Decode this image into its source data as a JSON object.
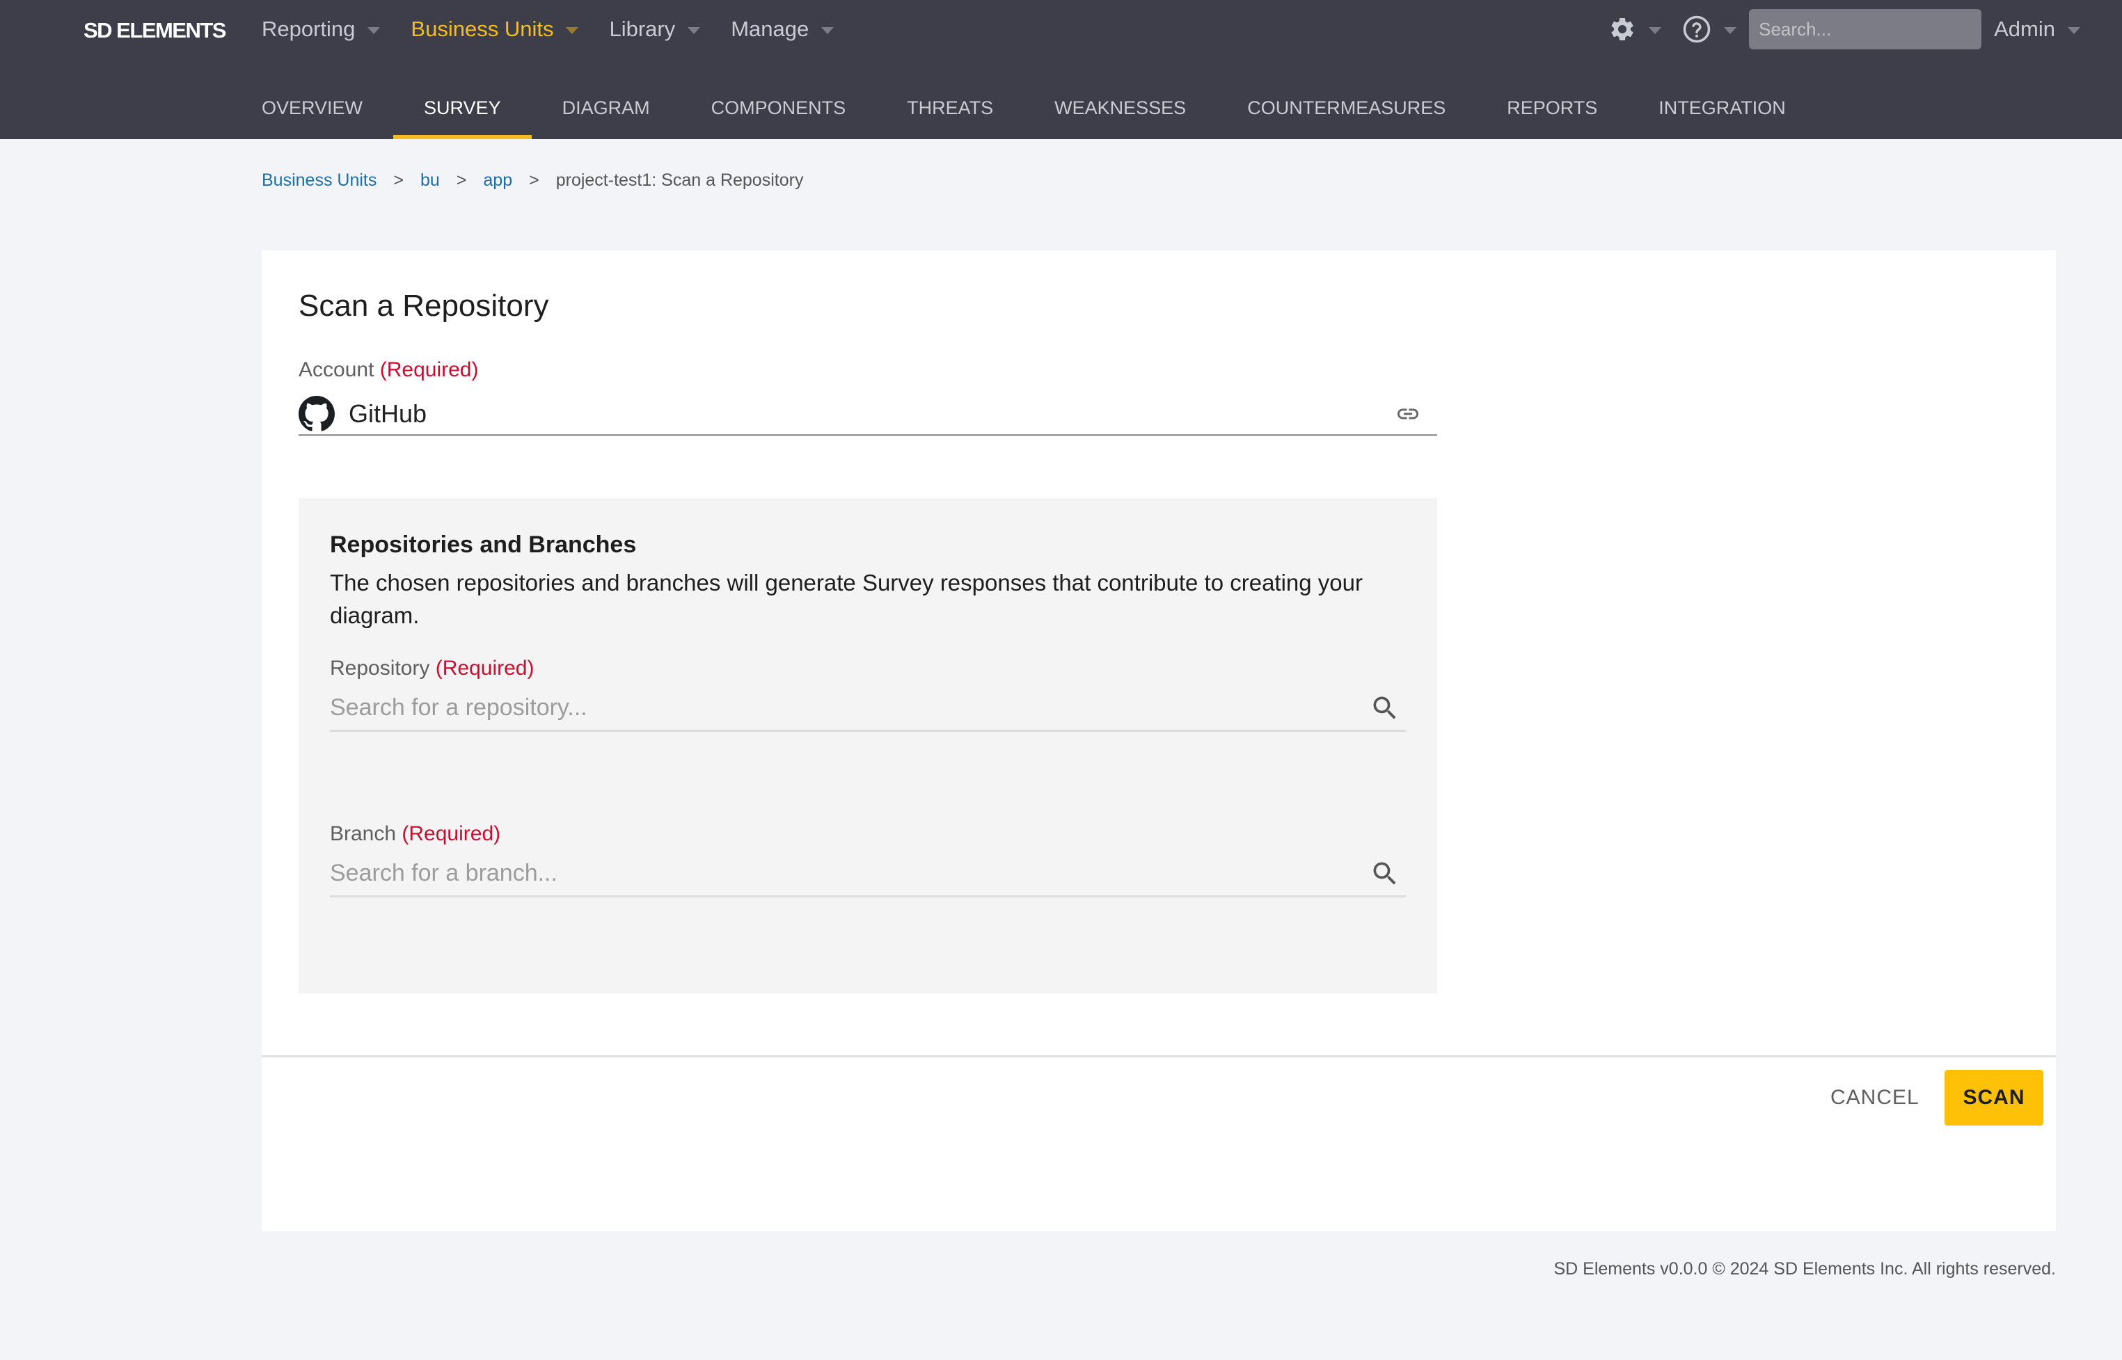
{
  "app": {
    "logo": "SD ELEMENTS"
  },
  "nav": {
    "menu": [
      {
        "label": "Reporting",
        "active": false
      },
      {
        "label": "Business Units",
        "active": true
      },
      {
        "label": "Library",
        "active": false
      },
      {
        "label": "Manage",
        "active": false
      }
    ],
    "settings_icon": "gear-icon",
    "help_icon": "help-circle-icon",
    "search_placeholder": "Search...",
    "user": "Admin"
  },
  "tabs": [
    {
      "label": "OVERVIEW",
      "active": false
    },
    {
      "label": "SURVEY",
      "active": true
    },
    {
      "label": "DIAGRAM",
      "active": false
    },
    {
      "label": "COMPONENTS",
      "active": false
    },
    {
      "label": "THREATS",
      "active": false
    },
    {
      "label": "WEAKNESSES",
      "active": false
    },
    {
      "label": "COUNTERMEASURES",
      "active": false
    },
    {
      "label": "REPORTS",
      "active": false
    },
    {
      "label": "INTEGRATION",
      "active": false
    }
  ],
  "breadcrumb": {
    "links": [
      "Business Units",
      "bu",
      "app"
    ],
    "separator": ">",
    "current": "project-test1: Scan a Repository"
  },
  "form": {
    "title": "Scan a Repository",
    "required_text": "(Required)",
    "account": {
      "label": "Account",
      "value": "GitHub",
      "icon": "github-icon",
      "action_icon": "link-icon"
    },
    "repos_panel": {
      "title": "Repositories and Branches",
      "description": "The chosen repositories and branches will generate Survey responses that contribute to creating your diagram.",
      "repository": {
        "label": "Repository",
        "placeholder": "Search for a repository...",
        "value": ""
      },
      "branch": {
        "label": "Branch",
        "placeholder": "Search for a branch...",
        "value": ""
      }
    },
    "cancel_label": "CANCEL",
    "scan_label": "SCAN"
  },
  "footer": {
    "text": "SD Elements v0.0.0 © 2024 SD Elements Inc. All rights reserved."
  },
  "colors": {
    "nav_bg": "#3e3e4a",
    "accent": "#ffc107",
    "active_menu": "#f5bd1f",
    "required": "#c8102e",
    "link": "#1a6fa8"
  }
}
